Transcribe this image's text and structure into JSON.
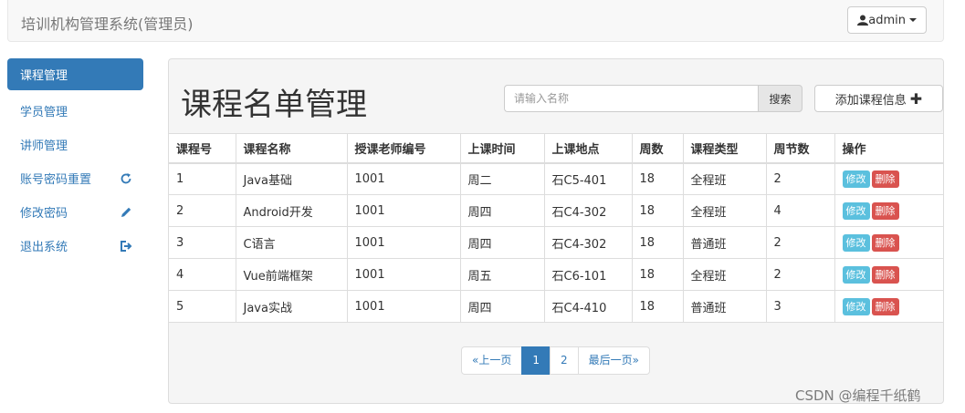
{
  "navbar": {
    "brand": "培训机构管理系统(管理员)",
    "user_label": "admin",
    "user_icon": "user-icon"
  },
  "sidebar": {
    "items": [
      {
        "label": "课程管理",
        "active": true
      },
      {
        "label": "学员管理"
      },
      {
        "label": "讲师管理"
      },
      {
        "label": "账号密码重置",
        "icon": "refresh-icon"
      },
      {
        "label": "修改密码",
        "icon": "pencil-icon"
      },
      {
        "label": "退出系统",
        "icon": "logout-icon"
      }
    ]
  },
  "main": {
    "title": "课程名单管理",
    "search": {
      "placeholder": "请输入名称",
      "button": "搜索"
    },
    "add_button": "添加课程信息",
    "table": {
      "headers": [
        "课程号",
        "课程名称",
        "授课老师编号",
        "上课时间",
        "上课地点",
        "周数",
        "课程类型",
        "周节数",
        "操作"
      ],
      "rows": [
        [
          "1",
          "Java基础",
          "1001",
          "周二",
          "石C5-401",
          "18",
          "全程班",
          "2"
        ],
        [
          "2",
          "Android开发",
          "1001",
          "周四",
          "石C4-302",
          "18",
          "全程班",
          "4"
        ],
        [
          "3",
          "C语言",
          "1001",
          "周四",
          "石C4-302",
          "18",
          "普通班",
          "2"
        ],
        [
          "4",
          "Vue前端框架",
          "1001",
          "周五",
          "石C6-101",
          "18",
          "全程班",
          "2"
        ],
        [
          "5",
          "Java实战",
          "1001",
          "周四",
          "石C4-410",
          "18",
          "普通班",
          "3"
        ]
      ],
      "edit_label": "修改",
      "delete_label": "删除"
    },
    "pagination": {
      "prev": "«上一页",
      "pages": [
        "1",
        "2"
      ],
      "current": "1",
      "last": "最后一页»"
    }
  },
  "watermark": "CSDN @编程千纸鹤",
  "colors": {
    "primary": "#337ab7",
    "info": "#5bc0de",
    "danger": "#d9534f"
  }
}
